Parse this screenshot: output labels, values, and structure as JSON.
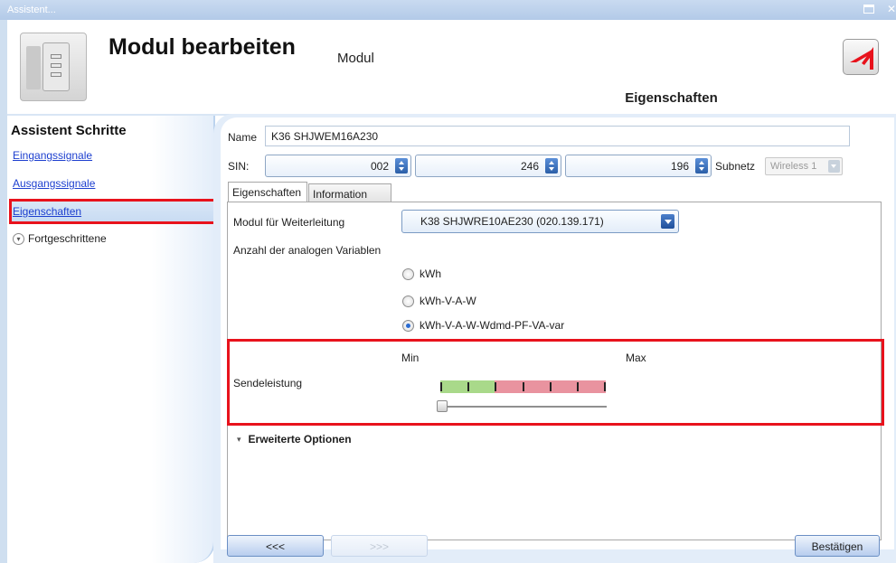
{
  "window": {
    "title": "Assistent..."
  },
  "header": {
    "title": "Modul bearbeiten",
    "subtitle": "Modul",
    "tab_label": "Eigenschaften"
  },
  "sidebar": {
    "title": "Assistent Schritte",
    "items": [
      {
        "label": "Eingangssignale"
      },
      {
        "label": "Ausgangssignale"
      },
      {
        "label": "Eigenschaften",
        "active": true
      },
      {
        "label": "Fortgeschrittene"
      }
    ]
  },
  "form": {
    "name_label": "Name",
    "name_value": "K36 SHJWEM16A230",
    "sin_label": "SIN:",
    "sin_values": [
      "002",
      "246",
      "196"
    ],
    "subnet_label": "Subnetz",
    "subnet_value": "Wireless 1"
  },
  "tabs": [
    {
      "label": "Eigenschaften",
      "selected": true
    },
    {
      "label": "Information",
      "selected": false
    }
  ],
  "properties": {
    "forward_label": "Modul für Weiterleitung",
    "forward_value": "K38 SHJWRE10AE230 (020.139.171)",
    "analog_label": "Anzahl der analogen Variablen",
    "analog_options": [
      {
        "label": "kWh",
        "selected": false
      },
      {
        "label": "kWh-V-A-W",
        "selected": false
      },
      {
        "label": "kWh-V-A-W-Wdmd-PF-VA-var",
        "selected": true
      }
    ],
    "power_label": "Sendeleistung",
    "power_min_label": "Min",
    "power_max_label": "Max",
    "power_level": 0,
    "scale_colors": {
      "low": "#a9d98a",
      "high": "#e9939f"
    },
    "expander_label": "Erweiterte Optionen"
  },
  "buttons": {
    "back": "<<<",
    "next": ">>>",
    "confirm": "Bestätigen"
  },
  "colors": {
    "highlight": "#e8121c",
    "link": "#1d3fcf",
    "accent": "#2b5fa8"
  }
}
